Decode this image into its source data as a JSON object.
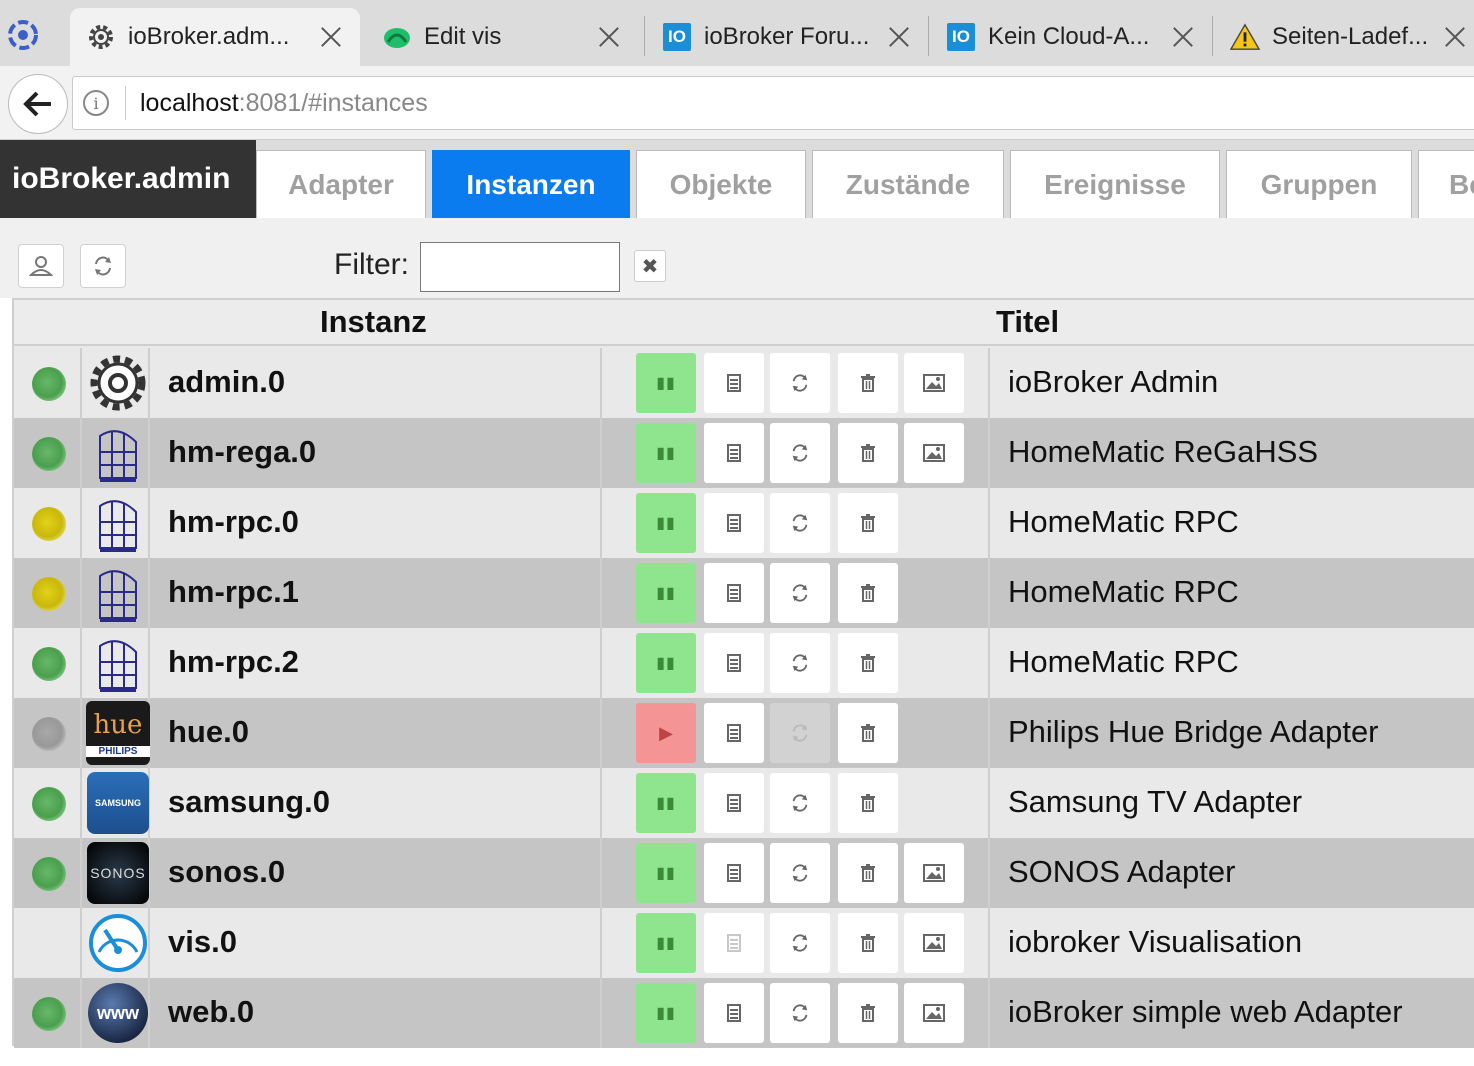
{
  "browser": {
    "tabs": [
      {
        "title": "ioBroker.adm...",
        "favicon": "gear-icon",
        "active": true
      },
      {
        "title": "Edit vis",
        "favicon": "vis-icon",
        "active": false
      },
      {
        "title": "ioBroker Foru...",
        "favicon": "iobroker-icon",
        "active": false
      },
      {
        "title": "Kein Cloud-A...",
        "favicon": "iobroker-icon",
        "active": false
      },
      {
        "title": "Seiten-Ladef...",
        "favicon": "warning-icon",
        "active": false
      }
    ],
    "url_host": "localhost",
    "url_rest": ":8081/#instances"
  },
  "app": {
    "brand": "ioBroker.admin",
    "tabs": [
      "Adapter",
      "Instanzen",
      "Objekte",
      "Zustände",
      "Ereignisse",
      "Gruppen",
      "Be"
    ],
    "active_tab": "Instanzen"
  },
  "toolbar": {
    "filter_label": "Filter:",
    "filter_value": "",
    "clear_symbol": "✖"
  },
  "table": {
    "col_instance": "Instanz",
    "col_title": "Titel",
    "rows": [
      {
        "instance": "admin.0",
        "title": "ioBroker Admin",
        "status": "green",
        "logo": "gear-icon",
        "running": true,
        "has_web": true
      },
      {
        "instance": "hm-rega.0",
        "title": "HomeMatic ReGaHSS",
        "status": "green",
        "logo": "homematic-icon",
        "running": true,
        "has_web": true
      },
      {
        "instance": "hm-rpc.0",
        "title": "HomeMatic RPC",
        "status": "yellow",
        "logo": "homematic-icon",
        "running": true,
        "has_web": false
      },
      {
        "instance": "hm-rpc.1",
        "title": "HomeMatic RPC",
        "status": "yellow",
        "logo": "homematic-icon",
        "running": true,
        "has_web": false
      },
      {
        "instance": "hm-rpc.2",
        "title": "HomeMatic RPC",
        "status": "green",
        "logo": "homematic-icon",
        "running": true,
        "has_web": false
      },
      {
        "instance": "hue.0",
        "title": "Philips Hue Bridge Adapter",
        "status": "grey",
        "logo": "hue-icon",
        "running": false,
        "has_web": false
      },
      {
        "instance": "samsung.0",
        "title": "Samsung TV Adapter",
        "status": "green",
        "logo": "samsung-icon",
        "running": true,
        "has_web": false
      },
      {
        "instance": "sonos.0",
        "title": "SONOS Adapter",
        "status": "green",
        "logo": "sonos-icon",
        "running": true,
        "has_web": true
      },
      {
        "instance": "vis.0",
        "title": "iobroker Visualisation",
        "status": "none",
        "logo": "vis-gauge-icon",
        "running": true,
        "has_web": true
      },
      {
        "instance": "web.0",
        "title": "ioBroker simple web Adapter",
        "status": "green",
        "logo": "www-globe-icon",
        "running": true,
        "has_web": true
      }
    ],
    "logo_texts": {
      "hue": "hue",
      "philips": "PHILIPS",
      "samsung": "SAMSUNG",
      "sonos": "SONOS",
      "www": "www"
    }
  },
  "colors": {
    "accent": "#0a7cf0",
    "status_green": "#4a9f4d",
    "status_yellow": "#c9b80a",
    "status_grey": "#999999",
    "button_running": "#8ee58e",
    "button_stopped": "#f59494"
  }
}
